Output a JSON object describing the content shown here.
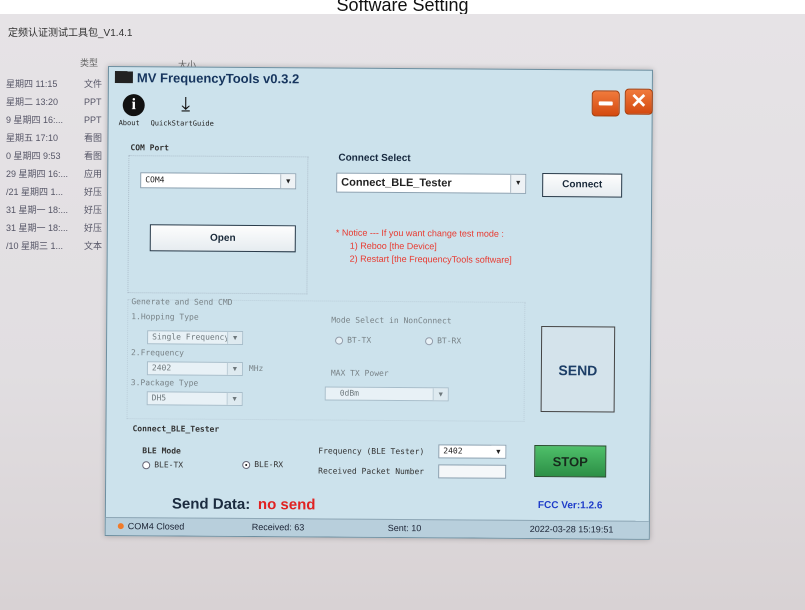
{
  "caption": "Software Setting",
  "background_window": {
    "title": "定频认证测试工具包_V1.4.1",
    "header_type": "类型",
    "header_size": "大小",
    "rows": [
      {
        "date": "星期四 11:15",
        "type": "文件"
      },
      {
        "date": "星期二 13:20",
        "type": "PPT"
      },
      {
        "date": "9 星期四 16:...",
        "type": "PPT"
      },
      {
        "date": "星期五 17:10",
        "type": "看图"
      },
      {
        "date": "0 星期四 9:53",
        "type": "看图"
      },
      {
        "date": "29 星期四 16:...",
        "type": "应用"
      },
      {
        "date": "/21 星期四 1...",
        "type": "好压"
      },
      {
        "date": "31 星期一 18:...",
        "type": "好压"
      },
      {
        "date": "31 星期一 18:...",
        "type": "好压"
      },
      {
        "date": "/10 星期三 1...",
        "type": "文本"
      }
    ]
  },
  "app": {
    "title": "MV FrequencyTools v0.3.2",
    "toolbar": {
      "about": "About",
      "quickstart": "QuickStartGuide"
    },
    "com_port": {
      "label": "COM Port",
      "value": "COM4",
      "open_button": "Open"
    },
    "connect_select": {
      "label": "Connect Select",
      "value": "Connect_BLE_Tester",
      "connect_button": "Connect"
    },
    "notice": {
      "line1": "* Notice --- If you want change test mode :",
      "line2": "1) Reboo [the Device]",
      "line3": "2) Restart [the FrequencyTools software]"
    },
    "generate": {
      "title": "Generate and Send CMD",
      "hopping_label": "1.Hopping Type",
      "hopping_value": "Single Frequency",
      "frequency_label": "2.Frequency",
      "frequency_value": "2402",
      "frequency_unit": "MHz",
      "package_label": "3.Package Type",
      "package_value": "DH5",
      "mode_label": "Mode Select in NonConnect",
      "mode_tx": "BT-TX",
      "mode_rx": "BT-RX",
      "max_power_label": "MAX TX Power",
      "max_power_value": "0dBm",
      "send_button": "SEND"
    },
    "ble_tester": {
      "title": "Connect_BLE_Tester",
      "mode_label": "BLE Mode",
      "tx": "BLE-TX",
      "rx": "BLE-RX",
      "freq_label": "Frequency (BLE Tester)",
      "freq_value": "2402",
      "received_label": "Received Packet Number",
      "received_value": "",
      "stop_button": "STOP"
    },
    "send_data": {
      "label": "Send Data:",
      "value": "no send"
    },
    "fcc_version": "FCC Ver:1.2.6",
    "status": {
      "port": "COM4 Closed",
      "received": "Received: 63",
      "sent": "Sent: 10",
      "datetime": "2022-03-28 15:19:51"
    }
  },
  "colors": {
    "accent": "#e8632a",
    "app_bg": "#cce2ec",
    "stop": "#3aa656",
    "notice": "#e83a30",
    "fcc": "#1d3bc9"
  }
}
